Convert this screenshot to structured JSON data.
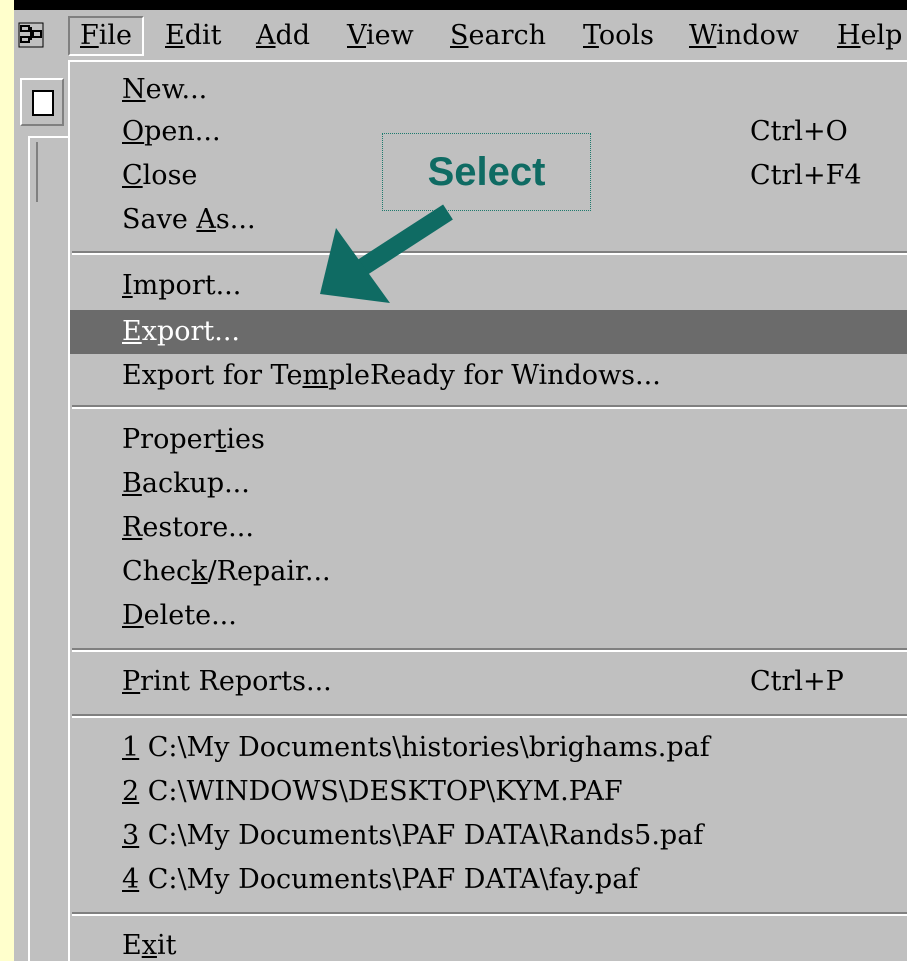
{
  "menubar": {
    "items": [
      {
        "label": "File",
        "u": "F",
        "rest": "ile"
      },
      {
        "label": "Edit",
        "u": "E",
        "rest": "dit"
      },
      {
        "label": "Add",
        "u": "A",
        "rest": "dd"
      },
      {
        "label": "View",
        "u": "V",
        "rest": "iew"
      },
      {
        "label": "Search",
        "u": "S",
        "rest": "earch"
      },
      {
        "label": "Tools",
        "u": "T",
        "rest": "ools"
      },
      {
        "label": "Window",
        "u": "W",
        "rest": "indow"
      },
      {
        "label": "Help",
        "u": "H",
        "rest": "elp"
      }
    ]
  },
  "file_menu": {
    "items": [
      {
        "pre": "",
        "u": "N",
        "post": "ew...",
        "shortcut": ""
      },
      {
        "pre": "",
        "u": "O",
        "post": "pen...",
        "shortcut": "Ctrl+O"
      },
      {
        "pre": "",
        "u": "C",
        "post": "lose",
        "shortcut": "Ctrl+F4"
      },
      {
        "pre": "Save ",
        "u": "A",
        "post": "s...",
        "shortcut": ""
      },
      {
        "pre": "",
        "u": "I",
        "post": "mport...",
        "shortcut": ""
      },
      {
        "pre": "",
        "u": "E",
        "post": "xport...",
        "shortcut": ""
      },
      {
        "pre": "Export for Te",
        "u": "m",
        "post": "pleReady for Windows...",
        "shortcut": ""
      },
      {
        "pre": "Proper",
        "u": "t",
        "post": "ies",
        "shortcut": ""
      },
      {
        "pre": "",
        "u": "B",
        "post": "ackup...",
        "shortcut": ""
      },
      {
        "pre": "",
        "u": "R",
        "post": "estore...",
        "shortcut": ""
      },
      {
        "pre": "Chec",
        "u": "k",
        "post": "/Repair...",
        "shortcut": ""
      },
      {
        "pre": "",
        "u": "D",
        "post": "elete...",
        "shortcut": ""
      },
      {
        "pre": "",
        "u": "P",
        "post": "rint Reports...",
        "shortcut": "Ctrl+P"
      },
      {
        "pre": "",
        "u": "1",
        "post": " C:\\My Documents\\histories\\brighams.paf",
        "shortcut": ""
      },
      {
        "pre": "",
        "u": "2",
        "post": " C:\\WINDOWS\\DESKTOP\\KYM.PAF",
        "shortcut": ""
      },
      {
        "pre": "",
        "u": "3",
        "post": " C:\\My Documents\\PAF DATA\\Rands5.paf",
        "shortcut": ""
      },
      {
        "pre": "",
        "u": "4",
        "post": " C:\\My Documents\\PAF DATA\\fay.paf",
        "shortcut": ""
      },
      {
        "pre": "E",
        "u": "x",
        "post": "it",
        "shortcut": ""
      }
    ]
  },
  "callout": {
    "text": "Select"
  },
  "colors": {
    "background": "#ffffcc",
    "menu": "#c0c0c0",
    "highlight": "#6b6b6b",
    "arrow": "#0f6b63"
  }
}
